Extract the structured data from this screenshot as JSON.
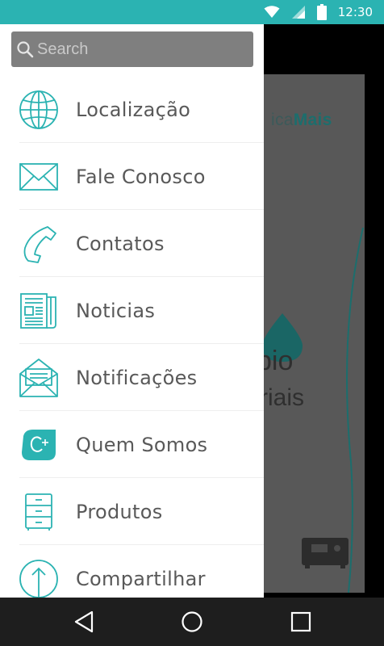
{
  "status_bar": {
    "time": "12:30",
    "icons": [
      "wifi-icon",
      "signal-icon",
      "battery-icon"
    ]
  },
  "search": {
    "placeholder": "Search"
  },
  "menu": {
    "items": [
      {
        "label": "Localização",
        "icon": "globe-icon"
      },
      {
        "label": "Fale Conosco",
        "icon": "envelope-icon"
      },
      {
        "label": "Contatos",
        "icon": "phone-icon"
      },
      {
        "label": "Noticias",
        "icon": "newspaper-icon"
      },
      {
        "label": "Notificações",
        "icon": "open-envelope-icon"
      },
      {
        "label": "Quem Somos",
        "icon": "brand-logo-icon"
      },
      {
        "label": "Produtos",
        "icon": "cabinet-icon"
      },
      {
        "label": "Compartilhar",
        "icon": "share-icon"
      }
    ]
  },
  "background": {
    "logo_prefix": "ica",
    "logo_suffix": "Mais",
    "text1": "bio",
    "text2": "riais"
  },
  "colors": {
    "accent": "#2bb3b2",
    "status_bar": "#2bb3b2",
    "nav_bar": "#1e1e1e",
    "menu_text": "#595959"
  },
  "nav_bar": {
    "buttons": [
      "back-icon",
      "home-icon",
      "recents-icon"
    ]
  }
}
